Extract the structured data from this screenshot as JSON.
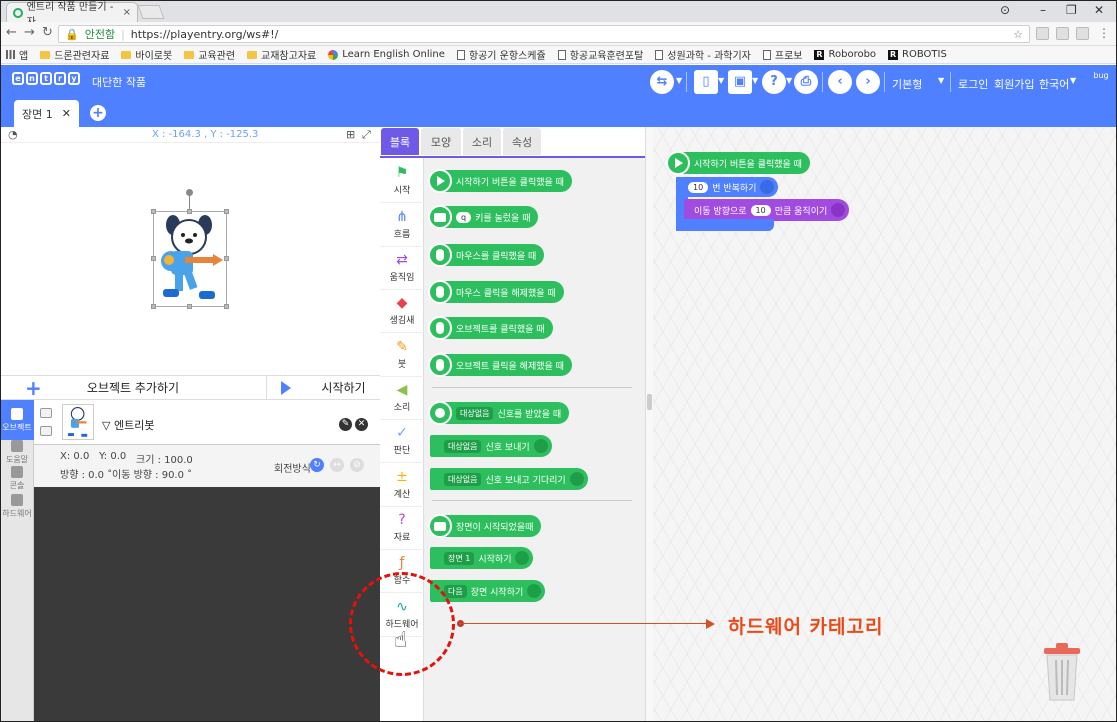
{
  "browser": {
    "tab_title": "엔트리 작품 만들기 - 자",
    "secure_label": "안전함",
    "url": "https://playentry.org/ws#!/",
    "bookmarks": [
      "앱",
      "드론관련자료",
      "바이로봇",
      "교육관련",
      "교재참고자료",
      "Learn English Online",
      "항공기 운항스케쥴",
      "항공교육훈련포탈",
      "성원과학 - 과학기자",
      "프로보",
      "Roborobo",
      "ROBOTIS"
    ]
  },
  "entry": {
    "logo": "entry",
    "project_title": "대단한 작품",
    "mode": "기본형",
    "login": "로그인",
    "signup": "회원가입",
    "language": "한국어",
    "bug": "bug"
  },
  "scene": {
    "tab_label": "장면 1",
    "close": "✕",
    "add": "+"
  },
  "stage": {
    "coords": "X : -164.3 , Y : -125.3"
  },
  "actions": {
    "add_object": "오브젝트 추가하기",
    "start": "시작하기"
  },
  "left_tabs": [
    "오브젝트",
    "도움말",
    "콘솔",
    "하드웨어"
  ],
  "object": {
    "name": "엔트리봇",
    "x": "X: 0.0",
    "y": "Y: 0.0",
    "size": "크기 : 100.0",
    "direction": "방향 : 0.0 ˚",
    "move_direction": "이동 방향 : 90.0 ˚",
    "rotation_label": "회전방식 :"
  },
  "menu_tabs": [
    "블록",
    "모양",
    "소리",
    "속성"
  ],
  "categories": [
    "시작",
    "흐름",
    "움직임",
    "생김새",
    "붓",
    "소리",
    "판단",
    "계산",
    "자료",
    "함수",
    "하드웨어"
  ],
  "palette": {
    "b1": "시작하기 버튼을 클릭했을 때",
    "b2_key": "q",
    "b2": "키를 눌렀을 때",
    "b3": "마우스를 클릭했을 때",
    "b4": "마우스 클릭을 해제했을 때",
    "b5": "오브젝트를 클릭했을 때",
    "b6": "오브젝트 클릭을 해제했을 때",
    "sig": "대상없음",
    "b7": "신호를 받았을 때",
    "b8": "신호 보내기",
    "b9": "신호 보내고 기다리기",
    "b10": "장면이 시작되었을때",
    "scene1": "장면 1",
    "b11": "시작하기",
    "next": "다음",
    "b12": "장면 시작하기"
  },
  "script": {
    "start": "시작하기 버튼을 클릭했을 때",
    "repeat_n": "10",
    "repeat": "번 반복하기",
    "move_pre": "이동 방향으로",
    "move_n": "10",
    "move_post": "만큼 움직이기"
  },
  "annotation": "하드웨어 카테고리"
}
